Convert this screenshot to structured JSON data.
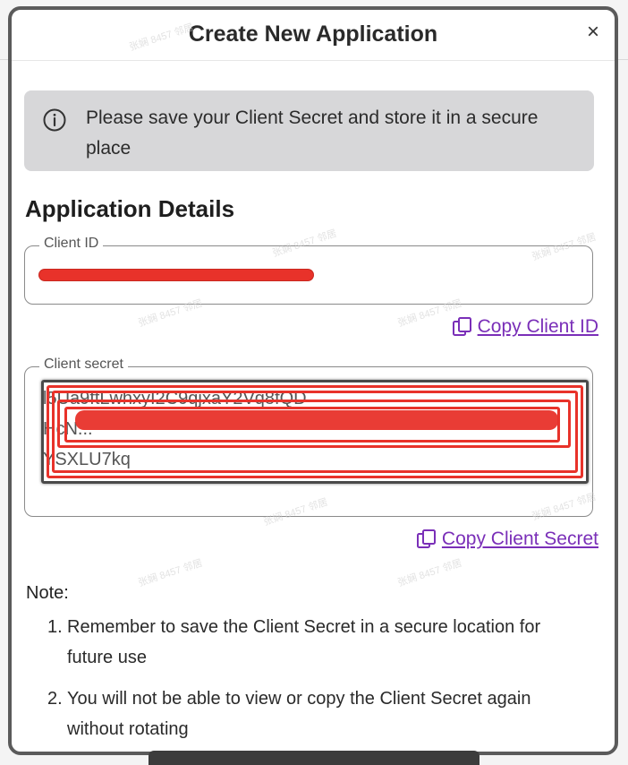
{
  "modal": {
    "title": "Create New Application",
    "close_label": "×"
  },
  "alert": {
    "icon": "info-icon",
    "text": "Please save your Client Secret and store it in a secure place"
  },
  "details": {
    "heading": "Application Details",
    "client_id": {
      "label": "Client ID",
      "value": "",
      "redacted": true,
      "copy_label": "Copy Client ID",
      "copy_icon": "copy-icon"
    },
    "client_secret": {
      "label": "Client secret",
      "line1": "l5Ua9ftLwhxyI2C9qjxaY2Vq8fQD",
      "line2": "HcN...",
      "line3": "YSXLU7kq",
      "redacted": true,
      "copy_label": "Copy Client Secret",
      "copy_icon": "copy-icon"
    }
  },
  "note": {
    "title": "Note:",
    "items": [
      {
        "num": "1.",
        "text": "Remember to save the Client Secret in a secure location for future use"
      },
      {
        "num": "2.",
        "text": "You will not be able to view or copy the Client Secret again without rotating"
      }
    ]
  },
  "colors": {
    "accent_link": "#7a2fb8",
    "alert_bg": "#d7d7d9",
    "redaction": "#e8322a"
  },
  "watermark": "张娴 8457 邻居"
}
